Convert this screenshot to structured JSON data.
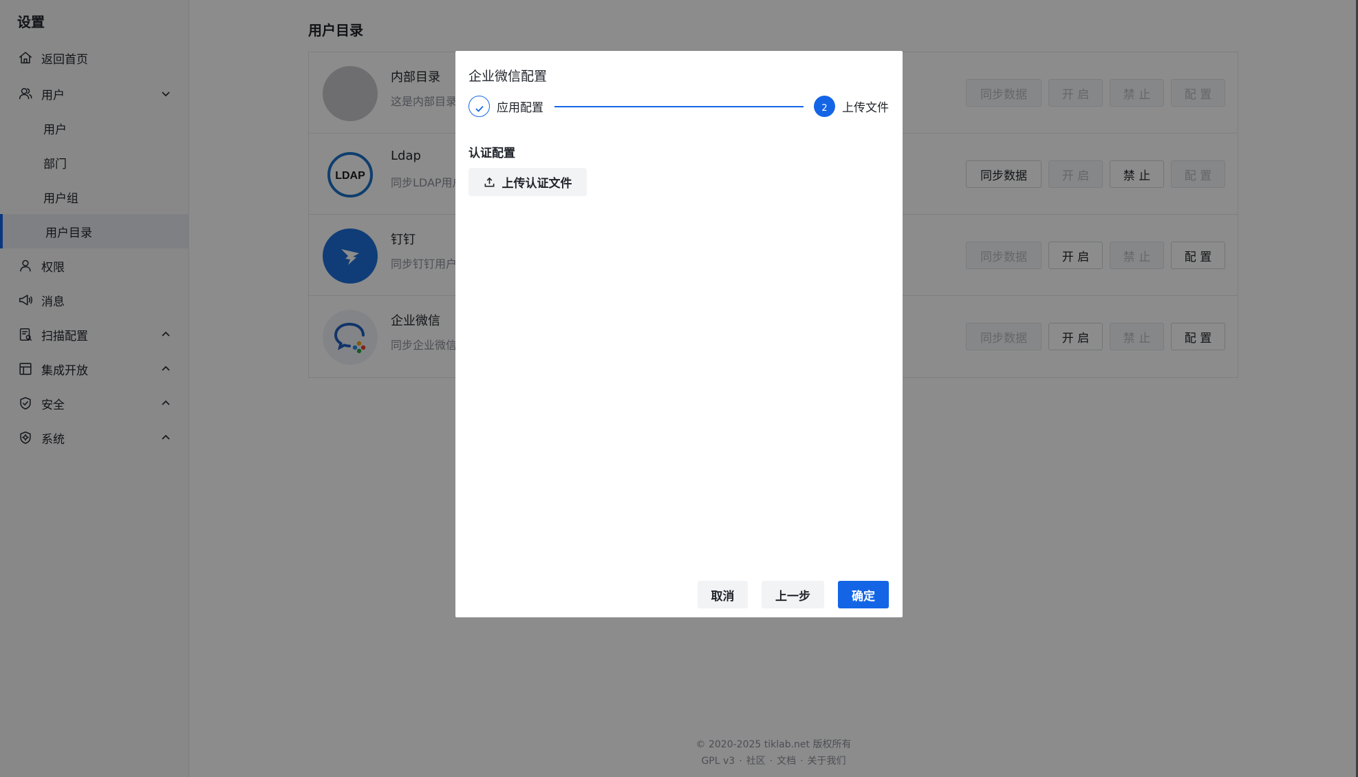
{
  "sidebar": {
    "title": "设置",
    "items": [
      {
        "label": "返回首页",
        "icon": "home-icon"
      },
      {
        "label": "用户",
        "icon": "user-icon"
      },
      {
        "label": "用户"
      },
      {
        "label": "部门"
      },
      {
        "label": "用户组"
      },
      {
        "label": "用户目录"
      },
      {
        "label": "权限",
        "icon": "permission-icon"
      },
      {
        "label": "消息",
        "icon": "megaphone-icon"
      },
      {
        "label": "扫描配置",
        "icon": "scan-config-icon"
      },
      {
        "label": "集成开放",
        "icon": "integration-icon"
      },
      {
        "label": "安全",
        "icon": "shield-icon"
      },
      {
        "label": "系统",
        "icon": "system-icon"
      }
    ]
  },
  "main": {
    "title": "用户目录",
    "directories": [
      {
        "name": "内部目录",
        "desc": "这是内部目录",
        "buttons": [
          "同步数据",
          "开 启",
          "禁 止",
          "配 置"
        ],
        "enabled": [
          false,
          false,
          false,
          false
        ]
      },
      {
        "name": "Ldap",
        "desc": "同步LDAP用户",
        "logo_text": "LDAP",
        "buttons": [
          "同步数据",
          "开 启",
          "禁 止",
          "配 置"
        ],
        "enabled": [
          true,
          false,
          true,
          false
        ]
      },
      {
        "name": "钉钉",
        "desc": "同步钉钉用户",
        "buttons": [
          "同步数据",
          "开 启",
          "禁 止",
          "配 置"
        ],
        "enabled": [
          false,
          true,
          false,
          true
        ]
      },
      {
        "name": "企业微信",
        "desc": "同步企业微信",
        "buttons": [
          "同步数据",
          "开 启",
          "禁 止",
          "配 置"
        ],
        "enabled": [
          false,
          true,
          false,
          true
        ]
      }
    ]
  },
  "footer": {
    "copyright": "© 2020-2025 tiklab.net 版权所有",
    "links": [
      "GPL v3",
      "社区",
      "文档",
      "关于我们"
    ]
  },
  "modal": {
    "title": "企业微信配置",
    "steps": [
      {
        "label": "应用配置",
        "status": "done"
      },
      {
        "label": "上传文件",
        "number": "2",
        "status": "active"
      }
    ],
    "section_label": "认证配置",
    "upload_label": "上传认证文件",
    "cancel_label": "取消",
    "prev_label": "上一步",
    "confirm_label": "确定"
  },
  "colors": {
    "primary": "#1465e6",
    "overlay": "rgba(0,0,0,0.45)",
    "dingtalk": "#1e6fd9",
    "ldap": "#1a72c9"
  }
}
